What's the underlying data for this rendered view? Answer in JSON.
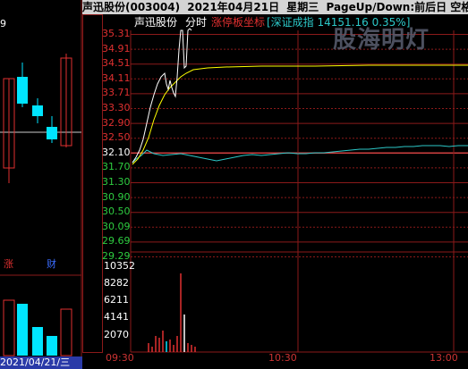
{
  "header": {
    "stock_name": "声迅股份(003004)",
    "date": "2021年04月21日",
    "weekday": "星期三",
    "hint": "PageUp/Down:前后日 空格键:操作"
  },
  "legend": {
    "stock_name": "声迅股份",
    "mode": "分时",
    "limit_axis": "涨停板坐标",
    "index_info": "[深证成指 14151.16 0.35%]"
  },
  "watermark": "股海明灯",
  "price_axis": {
    "labels": [
      "35.31",
      "34.91",
      "34.51",
      "34.11",
      "33.71",
      "33.30",
      "32.90",
      "32.50",
      "32.10",
      "31.70",
      "31.30",
      "30.90",
      "30.50",
      "30.09",
      "29.69",
      "29.29"
    ],
    "colors": [
      "#e03030",
      "#e03030",
      "#e03030",
      "#e03030",
      "#e03030",
      "#e03030",
      "#e03030",
      "#e03030",
      "#ffffff",
      "#2ecc40",
      "#2ecc40",
      "#2ecc40",
      "#2ecc40",
      "#2ecc40",
      "#2ecc40",
      "#2ecc40"
    ],
    "prev_close": "32.10"
  },
  "volume_axis": {
    "labels": [
      "10352",
      "8282",
      "6211",
      "4141",
      "2070"
    ]
  },
  "time_axis": {
    "labels": [
      "09:30",
      "10:30",
      "13:00"
    ]
  },
  "kline_panel": {
    "top_label": "9",
    "badge_left": "涨",
    "badge_right": "财",
    "date_bar": "2021/04/21/三"
  },
  "colors": {
    "up": "#e03030",
    "down": "#00e5ff",
    "price_line": "#ffffff",
    "avg_line": "#ffff00",
    "index_line": "#2cc8c8",
    "grid": "#8b1a1a",
    "topbar_bg": "#d4d4d4"
  }
}
